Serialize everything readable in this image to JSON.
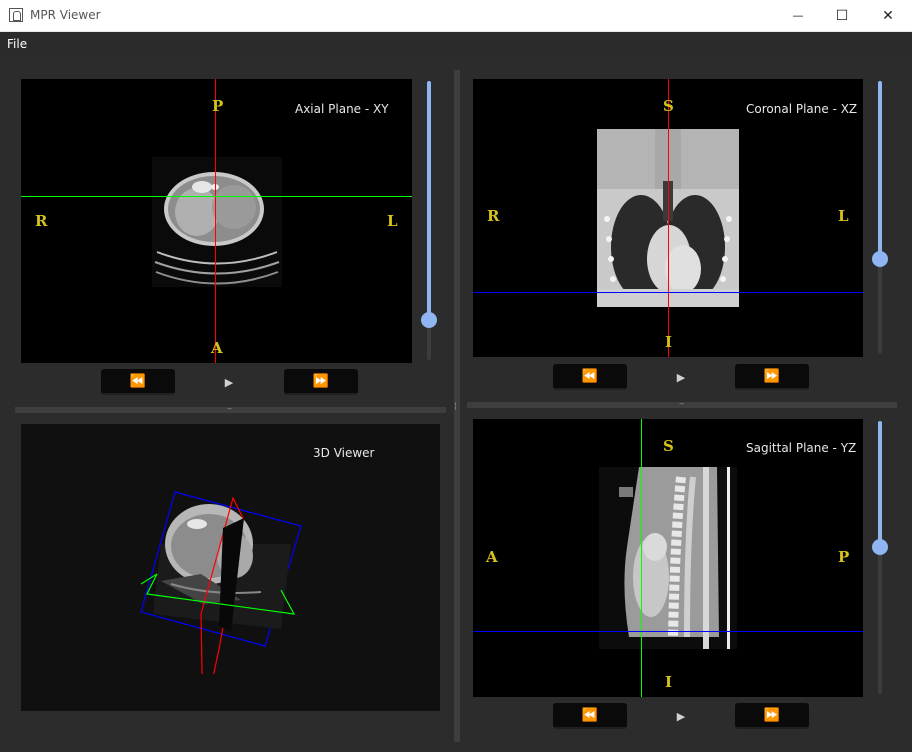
{
  "window": {
    "title": "MPR Viewer",
    "minimize_glyph": "—",
    "maximize_glyph": "☐",
    "close_glyph": "✕"
  },
  "menu": {
    "file": "File"
  },
  "views": {
    "axial": {
      "label": "Axial Plane - XY",
      "top": "P",
      "bottom": "A",
      "left": "R",
      "right": "L",
      "slider_level": 0.12
    },
    "coronal": {
      "label": "Coronal Plane - XZ",
      "top": "S",
      "bottom": "I",
      "left": "R",
      "right": "L",
      "slider_level": 0.34
    },
    "viewer3d": {
      "label": "3D Viewer"
    },
    "sagittal": {
      "label": "Sagittal Plane - YZ",
      "top": "S",
      "bottom": "I",
      "left": "A",
      "right": "P",
      "slider_level": 0.54
    }
  },
  "controls": {
    "rewind_glyph": "⏪",
    "forward_glyph": "⏩",
    "play_glyph": "▶"
  },
  "icons": {
    "app": "app-icon",
    "rewind": "rewind-icon",
    "play": "play-icon",
    "forward": "fast-forward-icon"
  },
  "colors": {
    "crosshair_red": "#ff0000",
    "crosshair_green": "#00ff00",
    "crosshair_blue": "#0000ff",
    "orientation_text": "#d6c21a",
    "slider": "#8fb5f3"
  }
}
